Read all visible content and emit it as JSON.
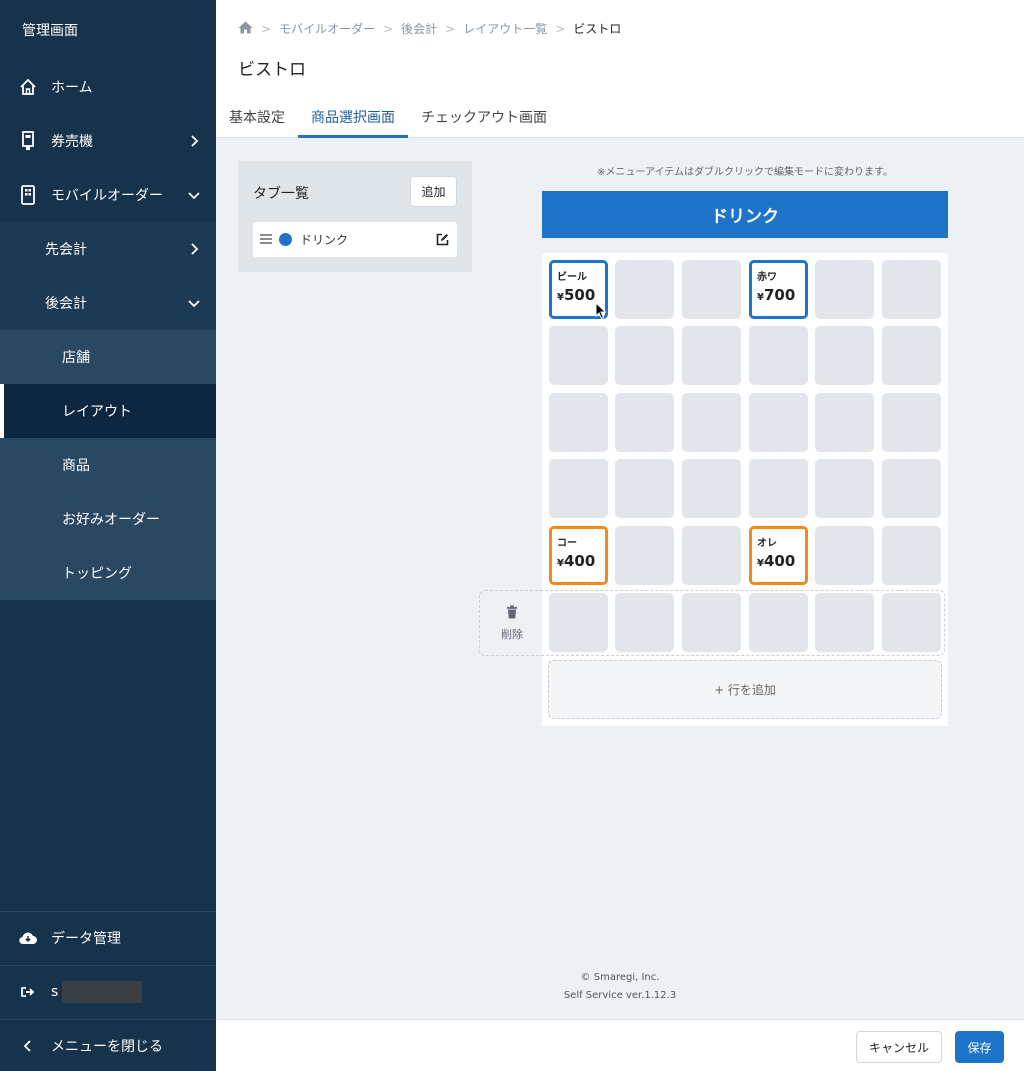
{
  "sidebar": {
    "title": "管理画面",
    "items": [
      {
        "label": "ホーム"
      },
      {
        "label": "券売機"
      },
      {
        "label": "モバイルオーダー"
      }
    ],
    "sub": [
      {
        "label": "先会計"
      },
      {
        "label": "後会計"
      }
    ],
    "sub3": [
      {
        "label": "店舗"
      },
      {
        "label": "レイアウト"
      },
      {
        "label": "商品"
      },
      {
        "label": "お好みオーダー"
      },
      {
        "label": "トッピング"
      }
    ],
    "data_manage": "データ管理",
    "user_initial": "s",
    "close_menu": "メニューを閉じる"
  },
  "breadcrumb": {
    "items": [
      "モバイルオーダー",
      "後会計",
      "レイアウト一覧"
    ],
    "current": "ビストロ"
  },
  "page_title": "ビストロ",
  "tabs": [
    {
      "label": "基本設定"
    },
    {
      "label": "商品選択画面"
    },
    {
      "label": "チェックアウト画面"
    }
  ],
  "tab_list": {
    "title": "タブ一覧",
    "add_label": "追加",
    "entries": [
      {
        "label": "ドリンク",
        "color": "#1e74c8"
      }
    ]
  },
  "grid": {
    "hint": "※メニューアイテムはダブルクリックで編集モードに変わります。",
    "header": "ドリンク",
    "items": [
      {
        "name": "ビール",
        "currency": "¥",
        "price": "500",
        "color": "blue"
      },
      {
        "name": "赤ワ",
        "currency": "¥",
        "price": "700",
        "color": "blue"
      },
      {
        "name": "コー",
        "currency": "¥",
        "price": "400",
        "color": "orange"
      },
      {
        "name": "オレ",
        "currency": "¥",
        "price": "400",
        "color": "orange"
      }
    ],
    "delete_label": "削除",
    "add_row_label": "+ 行を追加"
  },
  "footer": {
    "copyright": "© Smaregi, Inc.",
    "version": "Self Service ver.1.12.3"
  },
  "actions": {
    "cancel": "キャンセル",
    "save": "保存"
  },
  "colors": {
    "sidebar": "#17324b",
    "accent": "#1e74c8",
    "orange": "#f08a1c"
  }
}
